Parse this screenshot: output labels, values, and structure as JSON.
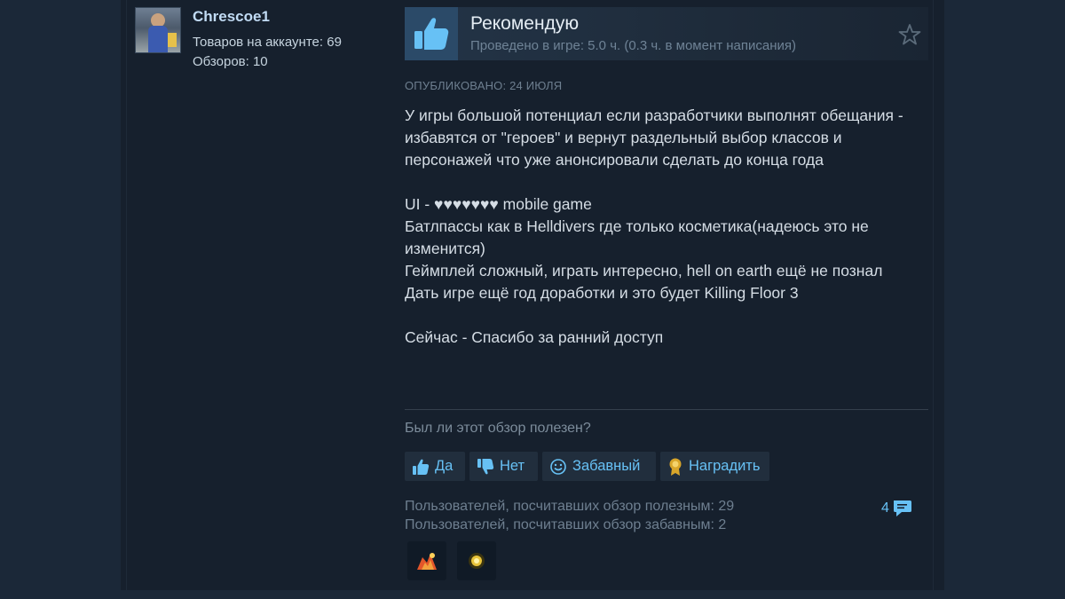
{
  "author": {
    "name": "Chrescoe1",
    "products_line": "Товаров на аккаунте: 69",
    "reviews_line": "Обзоров: 10"
  },
  "review": {
    "verdict": "Рекомендую",
    "hours": "Проведено в игре: 5.0 ч. (0.3 ч. в момент написания)",
    "posted": "ОПУБЛИКОВАНО: 24 ИЮЛЯ",
    "body": [
      "У игры большой потенциал если разработчики выполнят обещания - избавятся от \"героев\" и вернут раздельный выбор классов и персонажей что уже анонсировали сделать до конца года",
      "",
      "UI - ♥♥♥♥♥♥♥ mobile game",
      "Батлпассы как в Helldivers где только косметика(надеюсь это не изменится)",
      "Геймплей сложный, играть интересно, hell on earth ещё не познал",
      "Дать игре ещё год доработки и это будет Killing Floor 3",
      "",
      "Сейчас - Спасибо за ранний доступ"
    ]
  },
  "feedback": {
    "question": "Был ли этот обзор полезен?",
    "yes_label": "Да",
    "no_label": "Нет",
    "funny_label": "Забавный",
    "award_label": "Наградить",
    "helpful_count_line": "Пользователей, посчитавших обзор полезным: 29",
    "funny_count_line": "Пользователей, посчитавших обзор забавным: 2",
    "comments_count": "4"
  },
  "icons": {
    "verdict": "thumbs-up-icon",
    "favorite": "star-outline-icon",
    "yes": "thumbs-up-icon",
    "no": "thumbs-down-icon",
    "funny": "smiley-icon",
    "award": "award-ribbon-icon",
    "comments": "speech-bubble-icon",
    "award_badges": [
      "hot-take-award-icon",
      "golden-award-icon"
    ]
  },
  "colors": {
    "page_bg": "#1b2838",
    "panel_bg": "#16202d",
    "accent_link": "#67c1f5",
    "verdict_icon_bg": "#2b4a68"
  }
}
